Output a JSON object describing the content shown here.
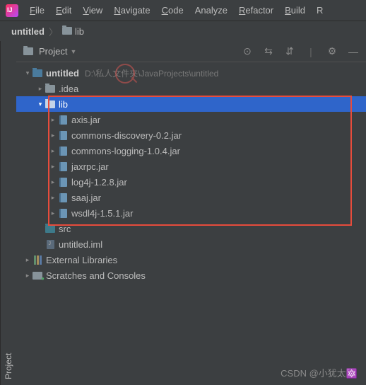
{
  "menu": [
    "File",
    "Edit",
    "View",
    "Navigate",
    "Code",
    "Analyze",
    "Refactor",
    "Build",
    "R"
  ],
  "breadcrumb": {
    "project": "untitled",
    "folder": "lib"
  },
  "toolwindow": {
    "title": "Project",
    "sidebar": "Project"
  },
  "tree": {
    "root": {
      "name": "untitled",
      "path": "D:\\私人文件夹\\JavaProjects\\untitled"
    },
    "idea": ".idea",
    "lib": {
      "name": "lib",
      "files": [
        "axis.jar",
        "commons-discovery-0.2.jar",
        "commons-logging-1.0.4.jar",
        "jaxrpc.jar",
        "log4j-1.2.8.jar",
        "saaj.jar",
        "wsdl4j-1.5.1.jar"
      ]
    },
    "src": "src",
    "iml": "untitled.iml",
    "ext": "External Libraries",
    "scratch": "Scratches and Consoles"
  },
  "watermark": "CSDN @小犹太🔯"
}
